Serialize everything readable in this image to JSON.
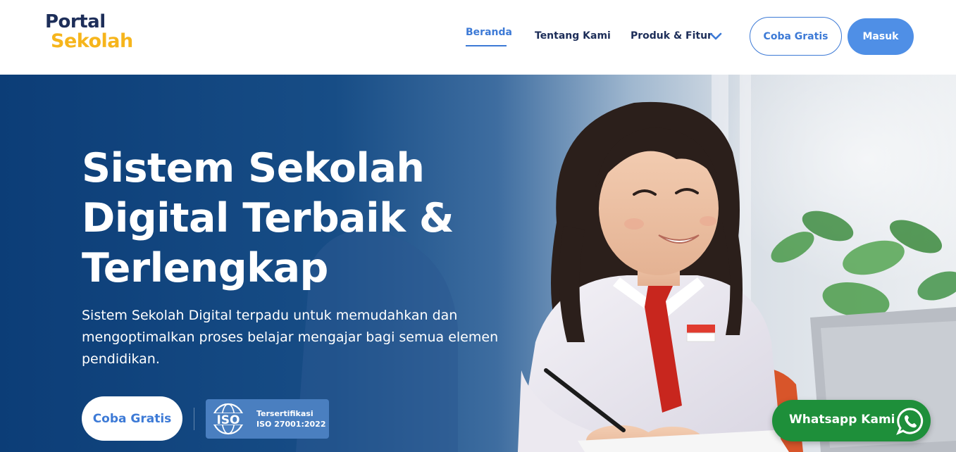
{
  "header": {
    "logo_line1": "Portal",
    "logo_line2": "Sekolah",
    "nav": [
      {
        "label": "Beranda",
        "active": true
      },
      {
        "label": "Tentang Kami",
        "active": false
      },
      {
        "label": "Produk & Fitur",
        "active": false,
        "icon": "chevron-down-icon"
      }
    ],
    "cta_trial": "Coba Gratis",
    "cta_login": "Masuk"
  },
  "hero": {
    "title_lines": [
      "Sistem Sekolah",
      "Digital Terbaik &",
      "Terlengkap"
    ],
    "subtitle_lines": [
      "Sistem Sekolah Digital terpadu untuk memudahkan dan",
      "mengoptimalkan proses belajar mengajar bagi semua elemen",
      "pendidikan."
    ],
    "cta": "Coba Gratis",
    "certification": {
      "logo_text": "ISO",
      "line1": "Tersertifikasi",
      "line2": "ISO 27001:2022"
    },
    "image": "girl-in-school-uniform-writing-photo"
  },
  "whatsapp": {
    "label": "Whatsapp Kami",
    "icon": "whatsapp-icon"
  },
  "colors": {
    "brand_navy": "#1d2e59",
    "brand_yellow": "#f6b51c",
    "accent_blue": "#3d7ad6",
    "hero_blue": "#0c3d77",
    "whatsapp_green": "#1e8f3a"
  }
}
